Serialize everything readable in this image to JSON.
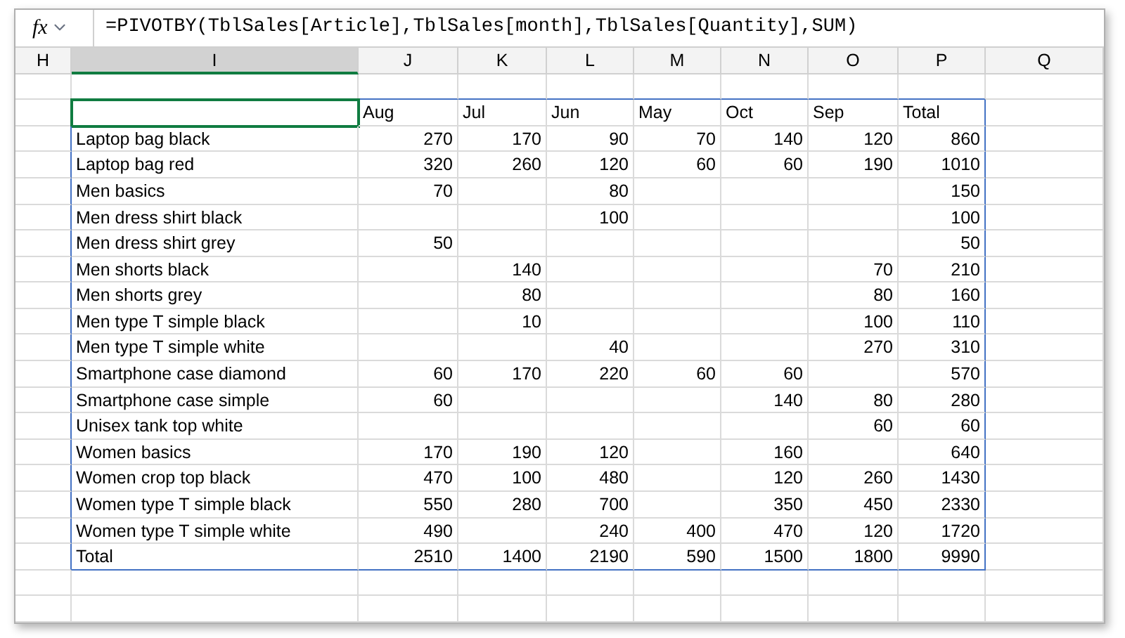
{
  "formula_bar": {
    "name_box_label": "fx",
    "formula": "=PIVOTBY(TblSales[Article],TblSales[month],TblSales[Quantity],SUM)"
  },
  "columns": [
    {
      "label": "H",
      "selected": false
    },
    {
      "label": "I",
      "selected": true
    },
    {
      "label": "J",
      "selected": false
    },
    {
      "label": "K",
      "selected": false
    },
    {
      "label": "L",
      "selected": false
    },
    {
      "label": "M",
      "selected": false
    },
    {
      "label": "N",
      "selected": false
    },
    {
      "label": "O",
      "selected": false
    },
    {
      "label": "P",
      "selected": false
    },
    {
      "label": "Q",
      "selected": false
    }
  ],
  "pivot": {
    "headers": {
      "aug": "Aug",
      "jul": "Jul",
      "jun": "Jun",
      "may": "May",
      "oct": "Oct",
      "sep": "Sep",
      "total": "Total"
    },
    "rows": [
      {
        "label": "Laptop bag black",
        "aug": "270",
        "jul": "170",
        "jun": "90",
        "may": "70",
        "oct": "140",
        "sep": "120",
        "total": "860"
      },
      {
        "label": "Laptop bag red",
        "aug": "320",
        "jul": "260",
        "jun": "120",
        "may": "60",
        "oct": "60",
        "sep": "190",
        "total": "1010"
      },
      {
        "label": "Men basics",
        "aug": "70",
        "jun": "80",
        "total": "150"
      },
      {
        "label": "Men dress shirt black",
        "jun": "100",
        "total": "100"
      },
      {
        "label": "Men dress shirt grey",
        "aug": "50",
        "total": "50"
      },
      {
        "label": "Men shorts black",
        "jul": "140",
        "sep": "70",
        "total": "210"
      },
      {
        "label": "Men shorts grey",
        "jul": "80",
        "sep": "80",
        "total": "160"
      },
      {
        "label": "Men type T simple black",
        "jul": "10",
        "sep": "100",
        "total": "110"
      },
      {
        "label": "Men type T simple white",
        "jun": "40",
        "sep": "270",
        "total": "310"
      },
      {
        "label": "Smartphone case diamond",
        "aug": "60",
        "jul": "170",
        "jun": "220",
        "may": "60",
        "oct": "60",
        "total": "570"
      },
      {
        "label": "Smartphone case simple",
        "aug": "60",
        "oct": "140",
        "sep": "80",
        "total": "280"
      },
      {
        "label": "Unisex tank top white",
        "sep": "60",
        "total": "60"
      },
      {
        "label": "Women basics",
        "aug": "170",
        "jul": "190",
        "jun": "120",
        "oct": "160",
        "total": "640"
      },
      {
        "label": "Women crop top black",
        "aug": "470",
        "jul": "100",
        "jun": "480",
        "oct": "120",
        "sep": "260",
        "total": "1430"
      },
      {
        "label": "Women type T simple black",
        "aug": "550",
        "jul": "280",
        "jun": "700",
        "oct": "350",
        "sep": "450",
        "total": "2330"
      },
      {
        "label": "Women type T simple white",
        "aug": "490",
        "jun": "240",
        "may": "400",
        "oct": "470",
        "sep": "120",
        "total": "1720"
      },
      {
        "label": "Total",
        "aug": "2510",
        "jul": "1400",
        "jun": "2190",
        "may": "590",
        "oct": "1500",
        "sep": "1800",
        "total": "9990"
      }
    ]
  }
}
